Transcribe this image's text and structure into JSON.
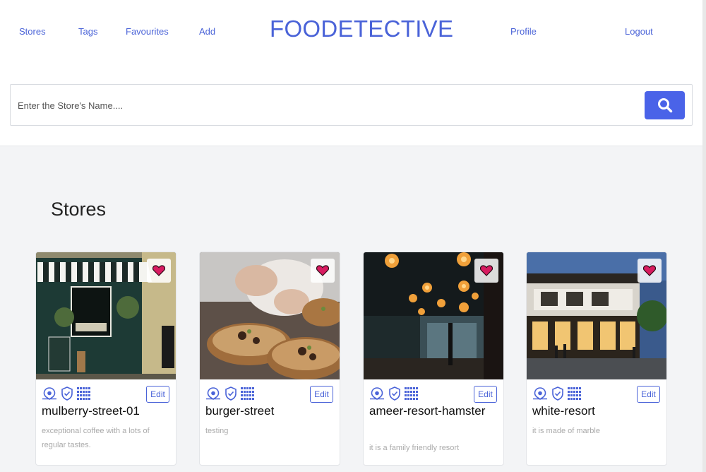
{
  "nav": {
    "stores": "Stores",
    "tags": "Tags",
    "favourites": "Favourites",
    "add": "Add",
    "brand": "FOODETECTIVE",
    "profile": "Profile",
    "logout": "Logout"
  },
  "search": {
    "placeholder": "Enter the Store's Name...."
  },
  "page": {
    "title": "Stores"
  },
  "stores": [
    {
      "name": "mulberry-street-01",
      "description": "exceptional coffee with a lots of regular tastes.",
      "edit_label": "Edit"
    },
    {
      "name": "burger-street",
      "description": "testing",
      "edit_label": "Edit"
    },
    {
      "name": "ameer-resort-hamster",
      "description": "it is a family friendly resort",
      "edit_label": "Edit"
    },
    {
      "name": "white-resort",
      "description": "it is made of marble",
      "edit_label": "Edit"
    }
  ],
  "icons": [
    "map-pin-icon",
    "shield-check-icon",
    "grid-icon",
    "heart-icon",
    "search-icon"
  ],
  "colors": {
    "accent": "#4a63d8",
    "button": "#4a63e8",
    "heart": "#c2185b"
  }
}
